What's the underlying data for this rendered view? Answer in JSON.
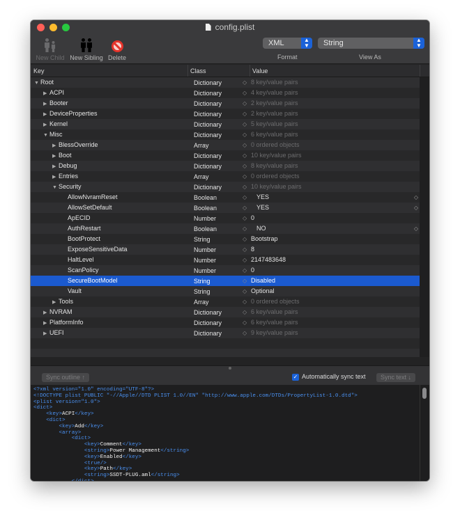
{
  "window": {
    "title": "config.plist",
    "traffic_lights": [
      "#ff5f57",
      "#febc2e",
      "#28c840"
    ]
  },
  "toolbar": {
    "new_child": "New Child",
    "new_sibling": "New Sibling",
    "delete": "Delete",
    "format": {
      "value": "XML",
      "label": "Format"
    },
    "view_as": {
      "value": "String",
      "label": "View As"
    }
  },
  "columns": {
    "key": "Key",
    "class": "Class",
    "value": "Value"
  },
  "colors": {
    "selection": "#1b5acf",
    "tag": "#4a90f0"
  },
  "rows": [
    {
      "key": "Root",
      "level": 0,
      "disclosure": "open",
      "class": "Dictionary",
      "value": "8 key/value pairs",
      "dim": true
    },
    {
      "key": "ACPI",
      "level": 1,
      "disclosure": "closed",
      "class": "Dictionary",
      "value": "4 key/value pairs",
      "dim": true
    },
    {
      "key": "Booter",
      "level": 1,
      "disclosure": "closed",
      "class": "Dictionary",
      "value": "2 key/value pairs",
      "dim": true
    },
    {
      "key": "DeviceProperties",
      "level": 1,
      "disclosure": "closed",
      "class": "Dictionary",
      "value": "2 key/value pairs",
      "dim": true
    },
    {
      "key": "Kernel",
      "level": 1,
      "disclosure": "closed",
      "class": "Dictionary",
      "value": "5 key/value pairs",
      "dim": true
    },
    {
      "key": "Misc",
      "level": 1,
      "disclosure": "open",
      "class": "Dictionary",
      "value": "6 key/value pairs",
      "dim": true
    },
    {
      "key": "BlessOverride",
      "level": 2,
      "disclosure": "closed",
      "class": "Array",
      "value": "0 ordered objects",
      "dim": true
    },
    {
      "key": "Boot",
      "level": 2,
      "disclosure": "closed",
      "class": "Dictionary",
      "value": "10 key/value pairs",
      "dim": true
    },
    {
      "key": "Debug",
      "level": 2,
      "disclosure": "closed",
      "class": "Dictionary",
      "value": "8 key/value pairs",
      "dim": true
    },
    {
      "key": "Entries",
      "level": 2,
      "disclosure": "closed",
      "class": "Array",
      "value": "0 ordered objects",
      "dim": true
    },
    {
      "key": "Security",
      "level": 2,
      "disclosure": "open",
      "class": "Dictionary",
      "value": "10 key/value pairs",
      "dim": true
    },
    {
      "key": "AllowNvramReset",
      "level": 3,
      "class": "Boolean",
      "value": "YES",
      "bool": true
    },
    {
      "key": "AllowSetDefault",
      "level": 3,
      "class": "Boolean",
      "value": "YES",
      "bool": true
    },
    {
      "key": "ApECID",
      "level": 3,
      "class": "Number",
      "value": "0"
    },
    {
      "key": "AuthRestart",
      "level": 3,
      "class": "Boolean",
      "value": "NO",
      "bool": true
    },
    {
      "key": "BootProtect",
      "level": 3,
      "class": "String",
      "value": "Bootstrap"
    },
    {
      "key": "ExposeSensitiveData",
      "level": 3,
      "class": "Number",
      "value": "8"
    },
    {
      "key": "HaltLevel",
      "level": 3,
      "class": "Number",
      "value": "2147483648"
    },
    {
      "key": "ScanPolicy",
      "level": 3,
      "class": "Number",
      "value": "0"
    },
    {
      "key": "SecureBootModel",
      "level": 3,
      "class": "String",
      "value": "Disabled",
      "selected": true
    },
    {
      "key": "Vault",
      "level": 3,
      "class": "String",
      "value": "Optional"
    },
    {
      "key": "Tools",
      "level": 2,
      "disclosure": "closed",
      "class": "Array",
      "value": "0 ordered objects",
      "dim": true
    },
    {
      "key": "NVRAM",
      "level": 1,
      "disclosure": "closed",
      "class": "Dictionary",
      "value": "6 key/value pairs",
      "dim": true
    },
    {
      "key": "PlatformInfo",
      "level": 1,
      "disclosure": "closed",
      "class": "Dictionary",
      "value": "6 key/value pairs",
      "dim": true
    },
    {
      "key": "UEFI",
      "level": 1,
      "disclosure": "closed",
      "class": "Dictionary",
      "value": "9 key/value pairs",
      "dim": true
    }
  ],
  "sync": {
    "outline": "Sync outline ↑",
    "auto": "Automatically sync text",
    "auto_checked": true,
    "text": "Sync text ↓"
  },
  "code_lines": [
    [
      [
        "t",
        "<?xml version=\"1.0\" encoding=\"UTF-8\"?>"
      ]
    ],
    [
      [
        "t",
        "<!DOCTYPE plist PUBLIC \"-//Apple//DTD PLIST 1.0//EN\" \"http://www.apple.com/DTDs/PropertyList-1.0.dtd\">"
      ]
    ],
    [
      [
        "t",
        "<plist version=\"1.0\">"
      ]
    ],
    [
      [
        "t",
        "<dict>"
      ]
    ],
    [
      [
        "x",
        "    "
      ],
      [
        "t",
        "<key>"
      ],
      [
        "x",
        "ACPI"
      ],
      [
        "t",
        "</key>"
      ]
    ],
    [
      [
        "x",
        "    "
      ],
      [
        "t",
        "<dict>"
      ]
    ],
    [
      [
        "x",
        "        "
      ],
      [
        "t",
        "<key>"
      ],
      [
        "x",
        "Add"
      ],
      [
        "t",
        "</key>"
      ]
    ],
    [
      [
        "x",
        "        "
      ],
      [
        "t",
        "<array>"
      ]
    ],
    [
      [
        "x",
        "            "
      ],
      [
        "t",
        "<dict>"
      ]
    ],
    [
      [
        "x",
        "                "
      ],
      [
        "t",
        "<key>"
      ],
      [
        "x",
        "Comment"
      ],
      [
        "t",
        "</key>"
      ]
    ],
    [
      [
        "x",
        "                "
      ],
      [
        "t",
        "<string>"
      ],
      [
        "x",
        "Power Management"
      ],
      [
        "t",
        "</string>"
      ]
    ],
    [
      [
        "x",
        "                "
      ],
      [
        "t",
        "<key>"
      ],
      [
        "x",
        "Enabled"
      ],
      [
        "t",
        "</key>"
      ]
    ],
    [
      [
        "x",
        "                "
      ],
      [
        "t",
        "<true/>"
      ]
    ],
    [
      [
        "x",
        "                "
      ],
      [
        "t",
        "<key>"
      ],
      [
        "x",
        "Path"
      ],
      [
        "t",
        "</key>"
      ]
    ],
    [
      [
        "x",
        "                "
      ],
      [
        "t",
        "<string>"
      ],
      [
        "x",
        "SSDT-PLUG.aml"
      ],
      [
        "t",
        "</string>"
      ]
    ],
    [
      [
        "x",
        "            "
      ],
      [
        "t",
        "</dict>"
      ]
    ]
  ]
}
